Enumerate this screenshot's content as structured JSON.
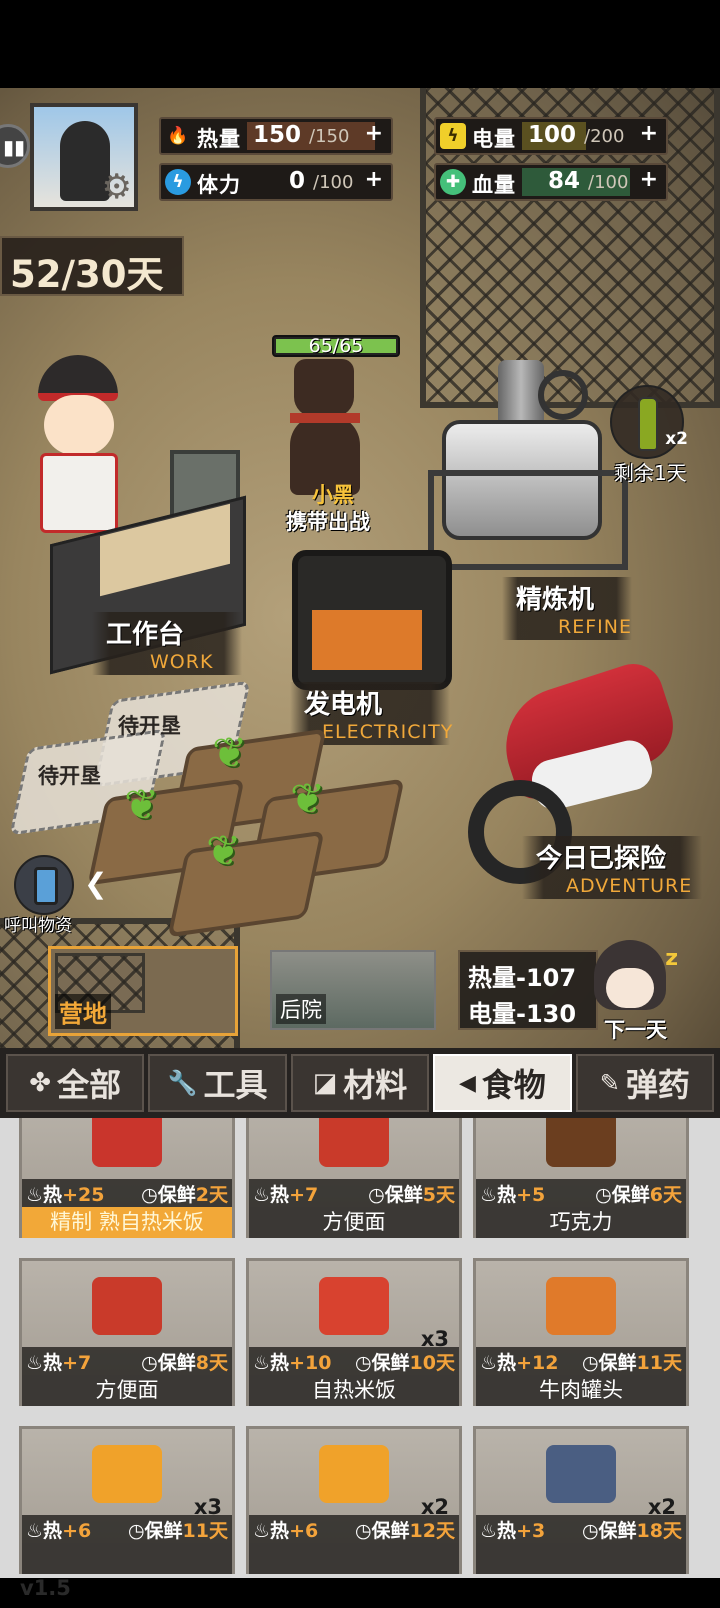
{
  "stats": {
    "heat": {
      "label": "热量",
      "value": "150",
      "max": "/150",
      "plus": "+",
      "fraction": 1.0
    },
    "stamina": {
      "label": "体力",
      "value": "0",
      "max": "/100",
      "plus": "+",
      "fraction": 0.0
    },
    "power": {
      "label": "电量",
      "value": "100",
      "max": "/200",
      "plus": "+",
      "fraction": 0.5
    },
    "health": {
      "label": "血量",
      "value": "84",
      "max": "/100",
      "plus": "+",
      "fraction": 0.84
    }
  },
  "days": "52/30天",
  "dog": {
    "hp": "65/65",
    "name": "小黑",
    "action": "携带出战"
  },
  "buildings": {
    "workbench": {
      "cn": "工作台",
      "en": "WORK"
    },
    "generator": {
      "cn": "发电机",
      "en": "ELECTRICITY"
    },
    "refine": {
      "cn": "精炼机",
      "en": "REFINE"
    },
    "adventure": {
      "cn": "今日已探险",
      "en": "ADVENTURE"
    }
  },
  "oil": {
    "qty": "x2",
    "remain": "剩余1天"
  },
  "plots": {
    "locked1": "待开垦",
    "locked2": "待开垦"
  },
  "call_supply": "呼叫物资",
  "locations": {
    "camp": "营地",
    "backyard": "后院"
  },
  "next_day": {
    "heat": "热量-107",
    "power": "电量-130",
    "label": "下一天"
  },
  "tabs": [
    {
      "icon": "✤",
      "label": "全部"
    },
    {
      "icon": "🔧",
      "label": "工具"
    },
    {
      "icon": "◪",
      "label": "材料"
    },
    {
      "icon": "◀",
      "label": "食物"
    },
    {
      "icon": "✎",
      "label": "弹药"
    }
  ],
  "items": [
    {
      "heat_key": "热",
      "heat": "+25",
      "fresh_key": "保鲜",
      "fresh": "2天",
      "name": "精制 熟自热米饭",
      "qty": "",
      "gold": true
    },
    {
      "heat_key": "热",
      "heat": "+7",
      "fresh_key": "保鲜",
      "fresh": "5天",
      "name": "方便面",
      "qty": ""
    },
    {
      "heat_key": "热",
      "heat": "+5",
      "fresh_key": "保鲜",
      "fresh": "6天",
      "name": "巧克力",
      "qty": ""
    },
    {
      "heat_key": "热",
      "heat": "+7",
      "fresh_key": "保鲜",
      "fresh": "8天",
      "name": "方便面",
      "qty": ""
    },
    {
      "heat_key": "热",
      "heat": "+10",
      "fresh_key": "保鲜",
      "fresh": "10天",
      "name": "自热米饭",
      "qty": "x3"
    },
    {
      "heat_key": "热",
      "heat": "+12",
      "fresh_key": "保鲜",
      "fresh": "11天",
      "name": "牛肉罐头",
      "qty": ""
    },
    {
      "heat_key": "热",
      "heat": "+6",
      "fresh_key": "保鲜",
      "fresh": "11天",
      "name": "",
      "qty": "x3"
    },
    {
      "heat_key": "热",
      "heat": "+6",
      "fresh_key": "保鲜",
      "fresh": "12天",
      "name": "",
      "qty": "x2"
    },
    {
      "heat_key": "热",
      "heat": "+3",
      "fresh_key": "保鲜",
      "fresh": "18天",
      "name": "",
      "qty": "x2"
    }
  ],
  "version": "v1.5",
  "colors": {
    "heat": "#e8482c",
    "stamina": "#2a9be0",
    "power": "#f0cf2a",
    "health": "#45c07a",
    "accent": "#f2a838"
  }
}
